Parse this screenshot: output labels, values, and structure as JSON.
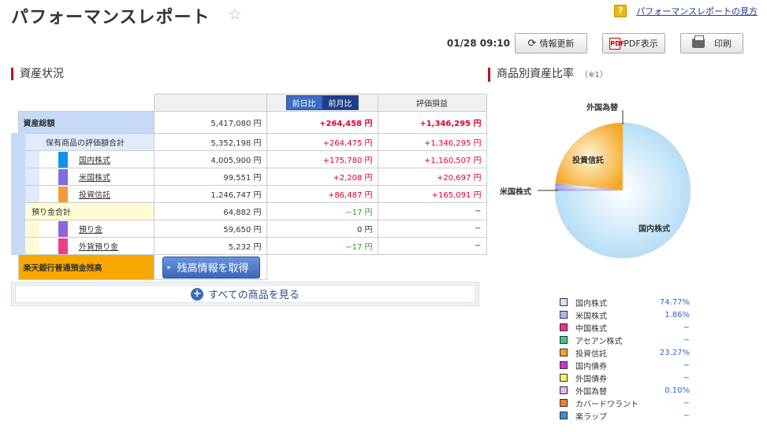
{
  "page": {
    "title": "パフォーマンスレポート",
    "help_link": "パフォーマンスレポートの見方"
  },
  "toolbar": {
    "time": "01/28 09:10",
    "refresh": "情報更新",
    "pdf": "PDF表示",
    "pdf_icon": "PDF",
    "print": "印刷"
  },
  "asset_section": {
    "title": "資産状況"
  },
  "ratio_section": {
    "title": "商品別資産比率",
    "note": "（※1）"
  },
  "table": {
    "tab_day": "前日比",
    "tab_month": "前月比",
    "col_pl": "評価損益",
    "total": {
      "label": "資産総額",
      "value": "5,417,080 円",
      "diff": "+264,458 円",
      "pl": "+1,346,295 円"
    },
    "holdings": {
      "label": "保有商品の評価額合計",
      "value": "5,352,198 円",
      "diff": "+264,475 円",
      "pl": "+1,346,295 円"
    },
    "domestic": {
      "label": "国内株式",
      "value": "4,005,900 円",
      "diff": "+175,780 円",
      "pl": "+1,160,507 円",
      "color": "#0a96e8"
    },
    "us": {
      "label": "米国株式",
      "value": "99,551 円",
      "diff": "+2,208 円",
      "pl": "+20,697 円",
      "color": "#7c6de0"
    },
    "fund": {
      "label": "投資信託",
      "value": "1,246,747 円",
      "diff": "+86,487 円",
      "pl": "+165,091 円",
      "color": "#f59a37"
    },
    "deposit_total": {
      "label": "預り金合計",
      "value": "64,882 円",
      "diff": "−17 円",
      "pl": "−"
    },
    "deposit": {
      "label": "預り金",
      "value": "59,650 円",
      "diff": "0 円",
      "pl": "−",
      "color": "#8b67d8"
    },
    "fx_deposit": {
      "label": "外貨預り金",
      "value": "5,232 円",
      "diff": "−17 円",
      "pl": "−",
      "color": "#ee3d86"
    },
    "bank": {
      "label": "楽天銀行普通預金残高",
      "button": "残高情報を取得"
    }
  },
  "all_products": "すべての商品を見る",
  "pie": {
    "labels": {
      "domestic": "国内株式",
      "fund": "投資信託",
      "us": "米国株式",
      "fx": "外国為替"
    }
  },
  "chart_data": {
    "type": "pie",
    "categories": [
      "国内株式",
      "米国株式",
      "中国株式",
      "アセアン株式",
      "投資信託",
      "国内債券",
      "外国債券",
      "外国為替",
      "カバードワラント",
      "楽ラップ"
    ],
    "values": [
      74.77,
      1.86,
      0,
      0,
      23.27,
      0,
      0,
      0.1,
      0,
      0
    ],
    "colors": [
      "#cfe8fa",
      "#b3b3f0",
      "#e6338a",
      "#33cc88",
      "#f5a623",
      "#cc33cc",
      "#f5f566",
      "#e6b8f0",
      "#f08033",
      "#3a8fd8"
    ]
  },
  "legend": [
    {
      "name": "国内株式",
      "pct": "74.77%",
      "color": "#cfe8fa"
    },
    {
      "name": "米国株式",
      "pct": "1.86%",
      "color": "#b3b3f0"
    },
    {
      "name": "中国株式",
      "pct": "−",
      "color": "#e6338a"
    },
    {
      "name": "アセアン株式",
      "pct": "−",
      "color": "#33cc88"
    },
    {
      "name": "投資信託",
      "pct": "23.27%",
      "color": "#f5a623"
    },
    {
      "name": "国内債券",
      "pct": "−",
      "color": "#cc33cc"
    },
    {
      "name": "外国債券",
      "pct": "−",
      "color": "#f5f566"
    },
    {
      "name": "外国為替",
      "pct": "0.10%",
      "color": "#e6b8f0"
    },
    {
      "name": "カバードワラント",
      "pct": "−",
      "color": "#f08033"
    },
    {
      "name": "楽ラップ",
      "pct": "−",
      "color": "#3a8fd8"
    }
  ]
}
